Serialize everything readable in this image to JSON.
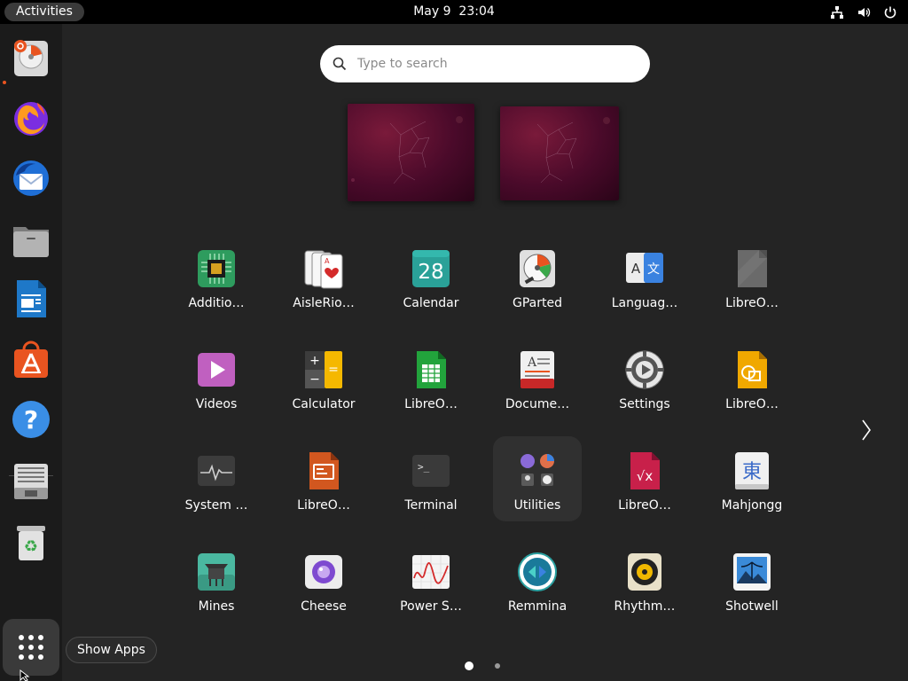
{
  "topbar": {
    "activities_label": "Activities",
    "date": "May 9",
    "time": "23:04"
  },
  "dock": {
    "items": [
      {
        "name": "disk-usage-icon"
      },
      {
        "name": "firefox-icon"
      },
      {
        "name": "thunderbird-icon"
      },
      {
        "name": "files-icon"
      },
      {
        "name": "libreoffice-writer-icon"
      },
      {
        "name": "app-center-icon"
      },
      {
        "name": "help-icon"
      },
      {
        "name": "text-editor-icon"
      },
      {
        "name": "trash-icon"
      }
    ],
    "tooltip": "Show Apps"
  },
  "search": {
    "placeholder": "Type to search"
  },
  "apps": [
    {
      "label": "Additio…",
      "icon": "additional-drivers-icon"
    },
    {
      "label": "AisleRio…",
      "icon": "aisleriot-icon"
    },
    {
      "label": "Calendar",
      "icon": "calendar-icon",
      "day": "28"
    },
    {
      "label": "GParted",
      "icon": "gparted-icon"
    },
    {
      "label": "Languag…",
      "icon": "language-support-icon"
    },
    {
      "label": "LibreO…",
      "icon": "libreoffice-icon"
    },
    {
      "label": "Videos",
      "icon": "videos-icon"
    },
    {
      "label": "Calculator",
      "icon": "calculator-icon"
    },
    {
      "label": "LibreO…",
      "icon": "libreoffice-calc-icon"
    },
    {
      "label": "Docume…",
      "icon": "document-viewer-icon"
    },
    {
      "label": "Settings",
      "icon": "settings-icon"
    },
    {
      "label": "LibreO…",
      "icon": "libreoffice-draw-icon"
    },
    {
      "label": "System …",
      "icon": "system-monitor-icon"
    },
    {
      "label": "LibreO…",
      "icon": "libreoffice-impress-icon"
    },
    {
      "label": "Terminal",
      "icon": "terminal-icon"
    },
    {
      "label": "Utilities",
      "icon": "utilities-folder-icon"
    },
    {
      "label": "LibreO…",
      "icon": "libreoffice-math-icon"
    },
    {
      "label": "Mahjongg",
      "icon": "mahjongg-icon",
      "glyph": "東"
    },
    {
      "label": "Mines",
      "icon": "mines-icon"
    },
    {
      "label": "Cheese",
      "icon": "cheese-icon"
    },
    {
      "label": "Power S…",
      "icon": "power-statistics-icon"
    },
    {
      "label": "Remmina",
      "icon": "remmina-icon"
    },
    {
      "label": "Rhythm…",
      "icon": "rhythmbox-icon"
    },
    {
      "label": "Shotwell",
      "icon": "shotwell-icon"
    }
  ],
  "pager": {
    "current_page": 1,
    "total_pages": 2
  },
  "colors": {
    "accent": "#e95420",
    "background": "#242424",
    "topbar": "#000000",
    "dock": "#1b1b1b"
  }
}
